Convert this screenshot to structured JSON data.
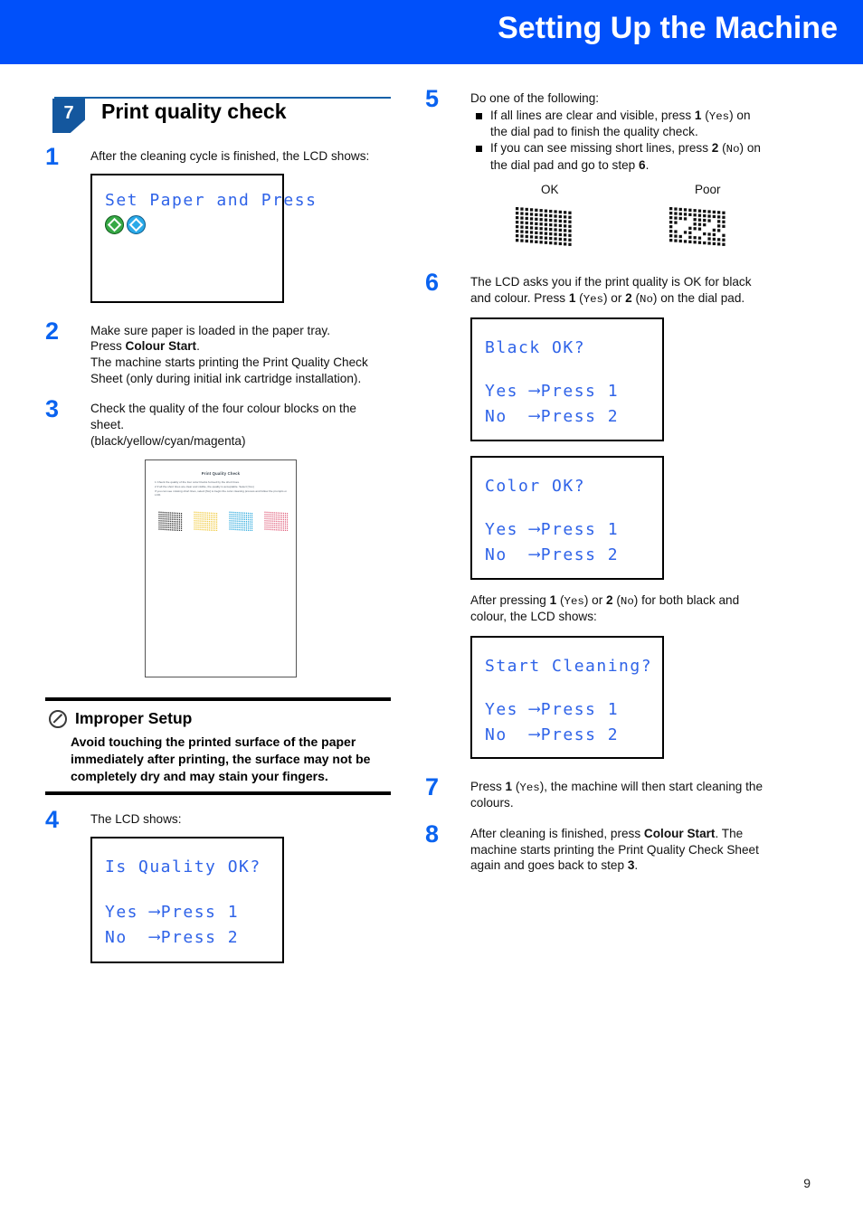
{
  "header": {
    "title": "Setting Up the Machine",
    "background_color": "#0050fa"
  },
  "section": {
    "number": "7",
    "title": "Print quality check",
    "badge_color": "#14579e"
  },
  "page_number": "9",
  "accent_color": "#0a63f0",
  "lcd_text_color": "#2f63e8",
  "left_column": {
    "step1": {
      "number": "1",
      "text": "After the cleaning cycle is finished, the LCD shows:",
      "lcd": {
        "line1": "Set Paper and Press",
        "buttons": [
          {
            "name": "mono-start",
            "color": "#36a845"
          },
          {
            "name": "colour-start",
            "color": "#2aa9e8"
          }
        ]
      }
    },
    "step2": {
      "number": "2",
      "line1a": "Make sure paper is loaded in the paper tray.",
      "line1b": "Press ",
      "bold1": "Colour Start",
      "line1c": ".",
      "line2": "The machine starts printing the Print Quality Check Sheet (only during initial ink cartridge installation)."
    },
    "step3": {
      "number": "3",
      "line1": "Check the quality of the four colour blocks on the sheet.",
      "line2": "(black/yellow/cyan/magenta)"
    },
    "sheet": {
      "title": "Print Quality Check",
      "instruction_lines": [
        "1  Check the quality of the four color blocks formed by the short lines.",
        "2  If all the short lines are clear and visible, the quality is acceptable. Select [Yes]",
        "    If you can see missing short lines, select [No] to begin the color cleaning process and follow the prompts on the",
        "    LCD."
      ],
      "block_colors": [
        "#2c2c2c",
        "#f0c93c",
        "#2ca9dd",
        "#e1637f"
      ],
      "block_names": [
        "black",
        "yellow",
        "cyan",
        "magenta"
      ]
    },
    "note": {
      "icon": "prohibition-icon",
      "title": "Improper Setup",
      "text": "Avoid touching the printed surface of the paper immediately after printing, the surface may not be completely dry and may stain your fingers."
    },
    "step4": {
      "number": "4",
      "text": "The LCD shows:",
      "lcd": {
        "line1": "Is Quality OK?",
        "line2_label": "Yes",
        "line2_value": "Press 1",
        "line3_label": "No",
        "line3_value": "Press 2"
      }
    }
  },
  "right_column": {
    "step5": {
      "number": "5",
      "intro": "Do one of the following:",
      "bullets": [
        {
          "pre": "If all lines are clear and visible, press ",
          "bold": "1",
          "mid": " (",
          "mono": "Yes",
          "post": ") on the dial pad to finish the quality check."
        },
        {
          "pre": "If you can see missing short lines, press ",
          "bold": "2",
          "mid": " (",
          "mono": "No",
          "post": ") on the dial pad and go to step ",
          "bold2": "6",
          "post2": "."
        }
      ],
      "samples": [
        {
          "label": "OK",
          "name": "sample-ok"
        },
        {
          "label": "Poor",
          "name": "sample-poor"
        }
      ]
    },
    "step6": {
      "number": "6",
      "text_a": "The LCD asks you if the print quality is OK for black and colour. Press ",
      "bold_1": "1",
      "text_b": " (",
      "mono_yes": "Yes",
      "text_c": ") or ",
      "bold_2": "2",
      "text_d": " (",
      "mono_no": "No",
      "text_e": ") on the dial pad.",
      "lcd_black": {
        "line1": "Black OK?",
        "line2_label": "Yes",
        "line2_value": "Press 1",
        "line3_label": "No",
        "line3_value": "Press 2"
      },
      "lcd_color": {
        "line1": "Color OK?",
        "line2_label": "Yes",
        "line2_value": "Press 1",
        "line3_label": "No",
        "line3_value": "Press 2"
      },
      "after_text_a": "After pressing ",
      "after_bold_1": "1",
      "after_text_b": " (",
      "after_mono_yes": "Yes",
      "after_text_c": ") or ",
      "after_bold_2": "2",
      "after_text_d": " (",
      "after_mono_no": "No",
      "after_text_e": ") for both black and colour, the LCD shows:",
      "lcd_cleaning": {
        "line1": "Start Cleaning?",
        "line2_label": "Yes",
        "line2_value": "Press 1",
        "line3_label": "No",
        "line3_value": "Press 2"
      }
    },
    "step7": {
      "number": "7",
      "text_a": "Press ",
      "bold_1": "1",
      "text_b": " (",
      "mono_yes": "Yes",
      "text_c": "), the machine will then start cleaning the colours."
    },
    "step8": {
      "number": "8",
      "text_a": "After cleaning is finished, press ",
      "bold_1": "Colour Start",
      "text_b": ". The machine starts printing the Print Quality Check Sheet again and goes back to step ",
      "bold_2": "3",
      "text_c": "."
    }
  }
}
